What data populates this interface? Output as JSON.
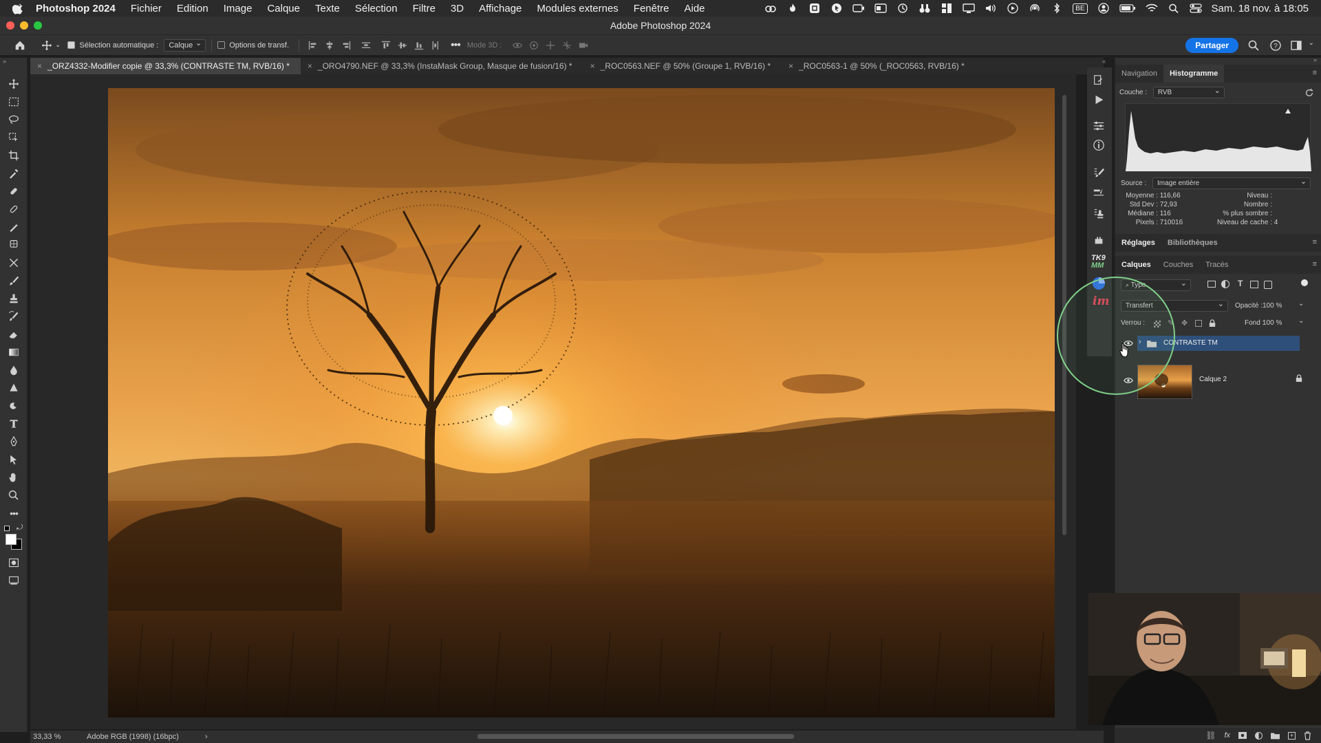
{
  "menubar": {
    "app": "Photoshop 2024",
    "items": [
      "Fichier",
      "Edition",
      "Image",
      "Calque",
      "Texte",
      "Sélection",
      "Filtre",
      "3D",
      "Affichage",
      "Modules externes",
      "Fenêtre",
      "Aide"
    ],
    "status_right": [
      "BE"
    ],
    "clock": "Sam. 18 nov. à 18:05"
  },
  "window": {
    "title": "Adobe Photoshop 2024"
  },
  "optionsbar": {
    "auto_select_label": "Sélection automatique :",
    "auto_select_value": "Calque",
    "transform_options_label": "Options de transf.",
    "mode3d_label": "Mode 3D :",
    "share_label": "Partager"
  },
  "tabs": [
    {
      "label": "_ORZ4332-Modifier copie @ 33,3% (CONTRASTE TM, RVB/16) *",
      "active": true
    },
    {
      "label": "_ORO4790.NEF @ 33,3% (InstaMask Group, Masque de fusion/16) *",
      "active": false
    },
    {
      "label": "_ROC0563.NEF @ 50% (Groupe 1, RVB/16) *",
      "active": false
    },
    {
      "label": "_ROC0563-1 @ 50% (_ROC0563, RVB/16) *",
      "active": false
    }
  ],
  "statusbar": {
    "zoom": "33,33 %",
    "profile": "Adobe RGB (1998) (16bpc)",
    "arrow": "›"
  },
  "panels": {
    "top_tabs": [
      "Navigation",
      "Histogramme"
    ],
    "histogram": {
      "channel_label": "Couche :",
      "channel_value": "RVB",
      "source_label": "Source :",
      "source_value": "Image entière",
      "stats_left": [
        {
          "label": "Moyenne :",
          "value": "116,66"
        },
        {
          "label": "Std Dev :",
          "value": "72,93"
        },
        {
          "label": "Médiane :",
          "value": "116"
        },
        {
          "label": "Pixels :",
          "value": "710016"
        }
      ],
      "stats_right": [
        {
          "label": "Niveau :",
          "value": ""
        },
        {
          "label": "Nombre :",
          "value": ""
        },
        {
          "label": "% plus sombre :",
          "value": ""
        },
        {
          "label": "Niveau de cache :",
          "value": "4"
        }
      ]
    },
    "mid_tabs": [
      "Réglages",
      "Bibliothèques"
    ],
    "layer_tabs": [
      "Calques",
      "Couches",
      "Tracés"
    ],
    "layers": {
      "filter_label": "Type",
      "blend_mode": "Transfert",
      "opacity_label": "Opacité :",
      "opacity_value": "100 %",
      "lock_label": "Verrou :",
      "fill_label": "Fond :",
      "fill_value": "100 %",
      "items": [
        {
          "name": "CONTRASTE TM",
          "type": "group",
          "selected": true
        },
        {
          "name": "Calque 2",
          "type": "pixel",
          "locked": true
        }
      ]
    }
  },
  "iconstrip": {
    "tk_label": "TK9",
    "tk_sub": "MM",
    "im_label": "im"
  },
  "colors": {
    "accent": "#1473e6",
    "selected_layer": "#2e4f7a",
    "highlight_circle": "#7fd08a"
  }
}
